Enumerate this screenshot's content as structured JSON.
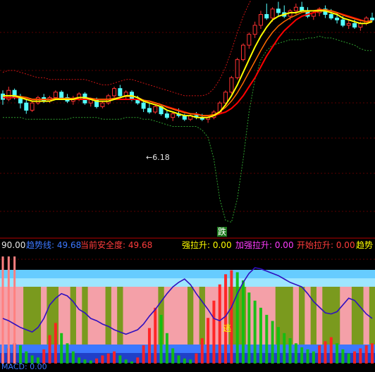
{
  "chart_data": [
    {
      "type": "candlestick",
      "panel": "price",
      "colors": {
        "up": "#ff3232",
        "down": "#54ffff",
        "ma_fast": "#ffff00",
        "ma_slow": "#ff0000",
        "ma_mid": "#ff6a00",
        "band_upper": "#c81414",
        "band_lower": "#2ea02e"
      },
      "candles": [
        {
          "o": 58,
          "h": 60,
          "l": 52,
          "c": 55
        },
        {
          "o": 55,
          "h": 62,
          "l": 54,
          "c": 60
        },
        {
          "o": 60,
          "h": 61,
          "l": 55,
          "c": 56
        },
        {
          "o": 56,
          "h": 58,
          "l": 50,
          "c": 53
        },
        {
          "o": 53,
          "h": 55,
          "l": 47,
          "c": 49
        },
        {
          "o": 49,
          "h": 54,
          "l": 48,
          "c": 53
        },
        {
          "o": 53,
          "h": 57,
          "l": 52,
          "c": 56
        },
        {
          "o": 56,
          "h": 58,
          "l": 53,
          "c": 54
        },
        {
          "o": 54,
          "h": 57,
          "l": 53,
          "c": 56
        },
        {
          "o": 56,
          "h": 60,
          "l": 55,
          "c": 59
        },
        {
          "o": 59,
          "h": 60,
          "l": 55,
          "c": 56
        },
        {
          "o": 56,
          "h": 58,
          "l": 53,
          "c": 54
        },
        {
          "o": 54,
          "h": 57,
          "l": 52,
          "c": 55
        },
        {
          "o": 55,
          "h": 59,
          "l": 54,
          "c": 58
        },
        {
          "o": 58,
          "h": 59,
          "l": 52,
          "c": 53
        },
        {
          "o": 53,
          "h": 56,
          "l": 51,
          "c": 55
        },
        {
          "o": 55,
          "h": 56,
          "l": 50,
          "c": 51
        },
        {
          "o": 51,
          "h": 54,
          "l": 50,
          "c": 53
        },
        {
          "o": 53,
          "h": 58,
          "l": 52,
          "c": 57
        },
        {
          "o": 57,
          "h": 62,
          "l": 56,
          "c": 61
        },
        {
          "o": 61,
          "h": 63,
          "l": 56,
          "c": 57
        },
        {
          "o": 57,
          "h": 60,
          "l": 55,
          "c": 59
        },
        {
          "o": 59,
          "h": 60,
          "l": 54,
          "c": 55
        },
        {
          "o": 55,
          "h": 57,
          "l": 52,
          "c": 53
        },
        {
          "o": 53,
          "h": 55,
          "l": 48,
          "c": 50
        },
        {
          "o": 50,
          "h": 53,
          "l": 47,
          "c": 48
        },
        {
          "o": 48,
          "h": 52,
          "l": 47,
          "c": 51
        },
        {
          "o": 51,
          "h": 52,
          "l": 46,
          "c": 47
        },
        {
          "o": 47,
          "h": 49,
          "l": 44,
          "c": 45
        },
        {
          "o": 45,
          "h": 48,
          "l": 43,
          "c": 47
        },
        {
          "o": 47,
          "h": 50,
          "l": 45,
          "c": 46
        },
        {
          "o": 46,
          "h": 47,
          "l": 43,
          "c": 44
        },
        {
          "o": 44,
          "h": 47,
          "l": 43,
          "c": 46
        },
        {
          "o": 46,
          "h": 48,
          "l": 44,
          "c": 45
        },
        {
          "o": 45,
          "h": 47,
          "l": 43,
          "c": 44
        },
        {
          "o": 44,
          "h": 46,
          "l": 42,
          "c": 45
        },
        {
          "o": 45,
          "h": 49,
          "l": 44,
          "c": 48
        },
        {
          "o": 48,
          "h": 54,
          "l": 47,
          "c": 53
        },
        {
          "o": 53,
          "h": 60,
          "l": 52,
          "c": 59
        },
        {
          "o": 59,
          "h": 68,
          "l": 58,
          "c": 67
        },
        {
          "o": 67,
          "h": 78,
          "l": 66,
          "c": 77
        },
        {
          "o": 77,
          "h": 86,
          "l": 76,
          "c": 85
        },
        {
          "o": 85,
          "h": 92,
          "l": 83,
          "c": 91
        },
        {
          "o": 91,
          "h": 98,
          "l": 89,
          "c": 96
        },
        {
          "o": 96,
          "h": 104,
          "l": 94,
          "c": 102
        },
        {
          "o": 102,
          "h": 108,
          "l": 99,
          "c": 100
        },
        {
          "o": 100,
          "h": 106,
          "l": 98,
          "c": 105
        },
        {
          "o": 105,
          "h": 109,
          "l": 101,
          "c": 103
        },
        {
          "o": 103,
          "h": 107,
          "l": 100,
          "c": 101
        },
        {
          "o": 101,
          "h": 105,
          "l": 99,
          "c": 104
        },
        {
          "o": 104,
          "h": 108,
          "l": 102,
          "c": 106
        },
        {
          "o": 106,
          "h": 109,
          "l": 103,
          "c": 104
        },
        {
          "o": 104,
          "h": 106,
          "l": 100,
          "c": 101
        },
        {
          "o": 101,
          "h": 104,
          "l": 99,
          "c": 103
        },
        {
          "o": 103,
          "h": 106,
          "l": 101,
          "c": 105
        },
        {
          "o": 105,
          "h": 107,
          "l": 100,
          "c": 102
        },
        {
          "o": 102,
          "h": 105,
          "l": 99,
          "c": 100
        },
        {
          "o": 100,
          "h": 103,
          "l": 97,
          "c": 99
        },
        {
          "o": 99,
          "h": 101,
          "l": 95,
          "c": 96
        },
        {
          "o": 96,
          "h": 99,
          "l": 94,
          "c": 97
        },
        {
          "o": 97,
          "h": 99,
          "l": 94,
          "c": 95
        },
        {
          "o": 95,
          "h": 98,
          "l": 93,
          "c": 97
        },
        {
          "o": 97,
          "h": 101,
          "l": 96,
          "c": 100
        },
        {
          "o": 100,
          "h": 103,
          "l": 98,
          "c": 99
        }
      ],
      "ma_fast": [
        57,
        57,
        57,
        56,
        55,
        54,
        54,
        54,
        54,
        55,
        55,
        55,
        55,
        56,
        56,
        55,
        54,
        54,
        54,
        55,
        56,
        57,
        57,
        56,
        54,
        53,
        52,
        51,
        49,
        48,
        47,
        46,
        46,
        45,
        45,
        45,
        46,
        48,
        52,
        57,
        63,
        70,
        77,
        84,
        90,
        95,
        99,
        101,
        102,
        103,
        103,
        104,
        104,
        104,
        104,
        104,
        103,
        102,
        100,
        99,
        98,
        97,
        97,
        98
      ],
      "ma_slow": [
        56,
        56,
        56,
        56,
        56,
        55,
        55,
        55,
        55,
        55,
        55,
        55,
        55,
        55,
        55,
        55,
        55,
        55,
        55,
        55,
        55,
        55,
        55,
        55,
        54,
        54,
        53,
        52,
        51,
        50,
        49,
        48,
        47,
        47,
        46,
        46,
        46,
        47,
        48,
        50,
        53,
        57,
        62,
        67,
        73,
        79,
        84,
        89,
        93,
        96,
        99,
        101,
        102,
        103,
        104,
        104,
        104,
        103,
        102,
        101,
        100,
        99,
        98,
        98
      ],
      "band_upper": [
        70,
        71,
        71,
        70,
        69,
        68,
        67,
        67,
        66,
        66,
        66,
        66,
        66,
        66,
        66,
        65,
        64,
        63,
        63,
        64,
        65,
        66,
        66,
        65,
        64,
        63,
        62,
        61,
        60,
        59,
        58,
        57,
        57,
        57,
        57,
        58,
        61,
        66,
        73,
        82,
        92,
        101,
        108,
        114,
        118,
        120,
        121,
        121,
        121,
        120,
        120,
        119,
        119,
        119,
        118,
        118,
        117,
        116,
        115,
        114,
        113,
        112,
        112,
        112
      ],
      "band_lower": [
        45,
        45,
        45,
        45,
        44,
        44,
        44,
        44,
        44,
        44,
        44,
        44,
        45,
        45,
        45,
        45,
        45,
        44,
        44,
        44,
        44,
        45,
        45,
        45,
        44,
        44,
        43,
        42,
        41,
        40,
        40,
        40,
        40,
        40,
        38,
        34,
        22,
        0,
        -12,
        -13,
        0,
        22,
        48,
        66,
        77,
        82,
        85,
        86,
        87,
        88,
        88,
        88,
        89,
        89,
        90,
        89,
        89,
        88,
        87,
        86,
        85,
        83,
        82,
        82
      ],
      "annotations": [
        {
          "text": "←6.18"
        },
        {
          "text": "跌"
        }
      ]
    },
    {
      "type": "bar",
      "panel": "indicator",
      "values": [
        {
          "label": "90.00"
        },
        {
          "label": "趋势线: 49.68"
        },
        {
          "label": "当前安全度: 49.68"
        },
        {
          "label": "强拉升: 0.00"
        },
        {
          "label": "加强拉升: 0.00"
        },
        {
          "label": "开始拉升: 0.00"
        },
        {
          "label": "趋势"
        }
      ],
      "bands": [
        1,
        1,
        1,
        1,
        0,
        0,
        0,
        1,
        0,
        0,
        1,
        1,
        0,
        1,
        0,
        1,
        1,
        1,
        0,
        1,
        0,
        1,
        1,
        1,
        1,
        1,
        1,
        0,
        1,
        1,
        1,
        1,
        0,
        1,
        0,
        1,
        1,
        1,
        1,
        0,
        0,
        0,
        1,
        1,
        1,
        1,
        1,
        0,
        0,
        0,
        1,
        0,
        1,
        0,
        1,
        0,
        0,
        0,
        1,
        1,
        0,
        0,
        1,
        0
      ],
      "trend_line": [
        40,
        38,
        35,
        32,
        30,
        28,
        32,
        40,
        52,
        58,
        62,
        60,
        55,
        48,
        45,
        40,
        38,
        35,
        33,
        30,
        28,
        26,
        28,
        30,
        35,
        42,
        48,
        55,
        62,
        68,
        72,
        75,
        70,
        62,
        55,
        48,
        40,
        38,
        42,
        50,
        62,
        72,
        80,
        85,
        84,
        82,
        80,
        78,
        75,
        72,
        70,
        68,
        62,
        55,
        50,
        45,
        44,
        46,
        52,
        58,
        56,
        50,
        44,
        40
      ],
      "safety": [
        10,
        15,
        20,
        18,
        12,
        8,
        6,
        14,
        28,
        40,
        30,
        20,
        12,
        6,
        4,
        3,
        5,
        8,
        10,
        12,
        8,
        4,
        2,
        6,
        18,
        35,
        55,
        48,
        30,
        15,
        8,
        5,
        4,
        10,
        25,
        45,
        62,
        78,
        88,
        92,
        90,
        82,
        70,
        62,
        55,
        48,
        42,
        36,
        30,
        25,
        20,
        16,
        14,
        12,
        18,
        22,
        26,
        20,
        14,
        10,
        12,
        15,
        18,
        20
      ],
      "labels": [
        {
          "text": "逃"
        },
        {
          "text": "MACD: 0.00"
        }
      ]
    }
  ]
}
